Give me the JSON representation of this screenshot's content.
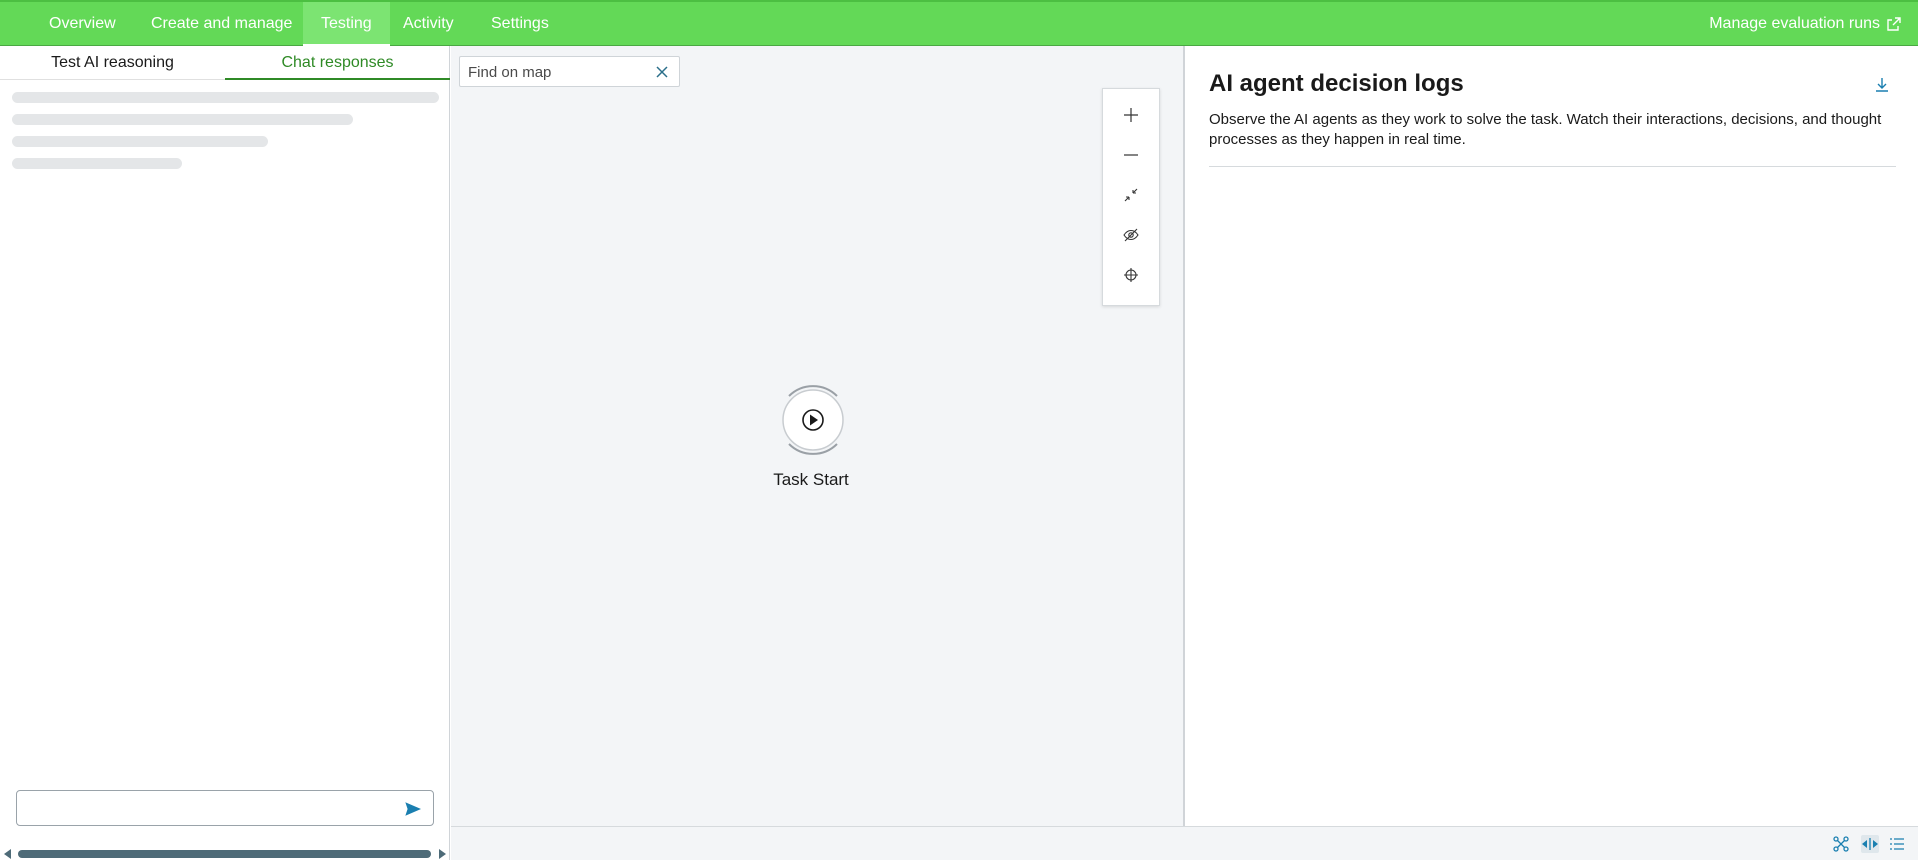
{
  "nav": {
    "tabs": [
      {
        "label": "Overview"
      },
      {
        "label": "Create and manage"
      },
      {
        "label": "Testing"
      },
      {
        "label": "Activity"
      },
      {
        "label": "Settings"
      }
    ],
    "active_tab": "Testing",
    "manage_link": "Manage evaluation runs",
    "manage_icon": "external-link-icon"
  },
  "left_panel": {
    "tabs": [
      {
        "label": "Test AI reasoning"
      },
      {
        "label": "Chat responses"
      }
    ],
    "active_tab": "Chat responses",
    "chat_input": {
      "value": "",
      "placeholder": ""
    },
    "send_icon": "send-icon"
  },
  "map": {
    "search": {
      "placeholder": "Find on map",
      "value": ""
    },
    "controls": [
      "zoom-in-icon",
      "zoom-out-icon",
      "fit-view-icon",
      "hide-icon",
      "center-icon"
    ],
    "node": {
      "label": "Task Start",
      "icon": "play-icon"
    }
  },
  "decision_logs": {
    "title": "AI agent decision logs",
    "description": "Observe the AI agents as they work to solve the task. Watch their interactions, decisions, and thought processes as they happen in real time.",
    "download_icon": "download-icon"
  },
  "bottom_bar": {
    "icons": [
      "graph-view-icon",
      "split-view-icon",
      "list-view-icon"
    ],
    "active_icon": "split-view-icon"
  },
  "colors": {
    "nav_bg": "#63d957",
    "accent_green": "#2f8a26",
    "scroll_thumb": "#4e6b78",
    "icon_blue": "#1a7fb0"
  }
}
